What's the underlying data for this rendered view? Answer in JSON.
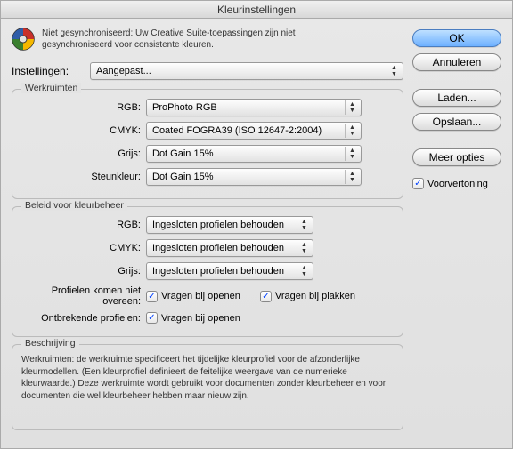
{
  "title": "Kleurinstellingen",
  "warning": "Niet gesynchroniseerd: Uw Creative Suite-toepassingen zijn niet gesynchroniseerd voor consistente kleuren.",
  "settings_label": "Instellingen:",
  "settings_value": "Aangepast...",
  "werkruimten": {
    "legend": "Werkruimten",
    "rgb_label": "RGB:",
    "rgb_value": "ProPhoto RGB",
    "cmyk_label": "CMYK:",
    "cmyk_value": "Coated FOGRA39 (ISO 12647-2:2004)",
    "grijs_label": "Grijs:",
    "grijs_value": "Dot Gain 15%",
    "steunkleur_label": "Steunkleur:",
    "steunkleur_value": "Dot Gain 15%"
  },
  "beleid": {
    "legend": "Beleid voor kleurbeheer",
    "rgb_label": "RGB:",
    "rgb_value": "Ingesloten profielen behouden",
    "cmyk_label": "CMYK:",
    "cmyk_value": "Ingesloten profielen behouden",
    "grijs_label": "Grijs:",
    "grijs_value": "Ingesloten profielen behouden",
    "mismatch_label": "Profielen komen niet overeen:",
    "missing_label": "Ontbrekende profielen:",
    "ask_open": "Vragen bij openen",
    "ask_paste": "Vragen bij plakken"
  },
  "beschrijving": {
    "legend": "Beschrijving",
    "text": "Werkruimten: de werkruimte specificeert het tijdelijke kleurprofiel voor de afzonderlijke kleurmodellen. (Een kleurprofiel definieert de feitelijke weergave van de numerieke kleurwaarde.) Deze werkruimte wordt gebruikt voor documenten zonder kleurbeheer en voor documenten die wel kleurbeheer hebben maar nieuw zijn."
  },
  "buttons": {
    "ok": "OK",
    "annuleren": "Annuleren",
    "laden": "Laden...",
    "opslaan": "Opslaan...",
    "meer_opties": "Meer opties",
    "voorvertoning": "Voorvertoning"
  }
}
